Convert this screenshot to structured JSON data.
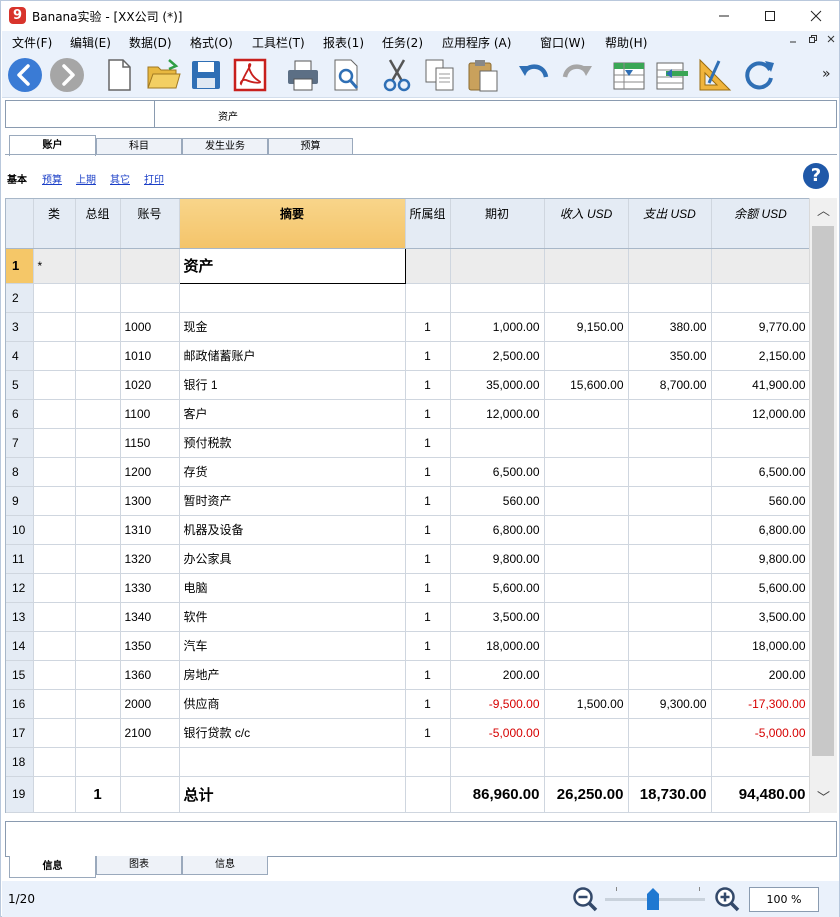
{
  "window": {
    "app_logo": "9",
    "title": "Banana实验 - [XX公司 (*)]",
    "minimize_icon": "minimize-icon",
    "maximize_icon": "maximize-icon",
    "close_icon": "close-icon"
  },
  "menu": {
    "items": [
      "文件(F)",
      "编辑(E)",
      "数据(D)",
      "格式(O)",
      "工具栏(T)",
      "报表(1)",
      "任务(2)",
      "应用程序  (A)",
      "窗口(W)",
      "帮助(H)"
    ]
  },
  "toolbar": {
    "buttons": [
      "back",
      "forward",
      "new-file",
      "open-file",
      "save",
      "pdf",
      "print",
      "print-preview",
      "cut",
      "copy",
      "paste",
      "undo",
      "redo",
      "insert-rows",
      "delete-rows",
      "ruler",
      "recheck"
    ],
    "more": "»"
  },
  "cellbar": {
    "address": "",
    "content": "资产"
  },
  "tables": {
    "tabs": [
      "账户",
      "科目",
      "发生业务",
      "预算"
    ],
    "active": "账户"
  },
  "views": {
    "items": [
      "基本",
      "预算",
      "上期",
      "其它",
      "打印"
    ],
    "current": "基本"
  },
  "help": {
    "label": "?"
  },
  "grid": {
    "columns": [
      "类",
      "总组",
      "账号",
      "摘要",
      "所属组",
      "期初",
      "收入 USD",
      "支出 USD",
      "余额 USD"
    ],
    "rows": [
      {
        "n": "1",
        "cls": "*",
        "grp": "",
        "acc": "",
        "desc": "资产",
        "gr": "",
        "open": "",
        "inc": "",
        "exp": "",
        "bal": ""
      },
      {
        "n": "2",
        "cls": "",
        "grp": "",
        "acc": "",
        "desc": "",
        "gr": "",
        "open": "",
        "inc": "",
        "exp": "",
        "bal": ""
      },
      {
        "n": "3",
        "cls": "",
        "grp": "",
        "acc": "1000",
        "desc": "现金",
        "gr": "1",
        "open": "1,000.00",
        "inc": "9,150.00",
        "exp": "380.00",
        "bal": "9,770.00"
      },
      {
        "n": "4",
        "cls": "",
        "grp": "",
        "acc": "1010",
        "desc": "邮政储蓄账户",
        "gr": "1",
        "open": "2,500.00",
        "inc": "",
        "exp": "350.00",
        "bal": "2,150.00"
      },
      {
        "n": "5",
        "cls": "",
        "grp": "",
        "acc": "1020",
        "desc": "银行 1",
        "gr": "1",
        "open": "35,000.00",
        "inc": "15,600.00",
        "exp": "8,700.00",
        "bal": "41,900.00"
      },
      {
        "n": "6",
        "cls": "",
        "grp": "",
        "acc": "1100",
        "desc": "客户",
        "gr": "1",
        "open": "12,000.00",
        "inc": "",
        "exp": "",
        "bal": "12,000.00"
      },
      {
        "n": "7",
        "cls": "",
        "grp": "",
        "acc": "1150",
        "desc": "预付税款",
        "gr": "1",
        "open": "",
        "inc": "",
        "exp": "",
        "bal": ""
      },
      {
        "n": "8",
        "cls": "",
        "grp": "",
        "acc": "1200",
        "desc": "存货",
        "gr": "1",
        "open": "6,500.00",
        "inc": "",
        "exp": "",
        "bal": "6,500.00"
      },
      {
        "n": "9",
        "cls": "",
        "grp": "",
        "acc": "1300",
        "desc": "暂时资产",
        "gr": "1",
        "open": "560.00",
        "inc": "",
        "exp": "",
        "bal": "560.00"
      },
      {
        "n": "10",
        "cls": "",
        "grp": "",
        "acc": "1310",
        "desc": "机器及设备",
        "gr": "1",
        "open": "6,800.00",
        "inc": "",
        "exp": "",
        "bal": "6,800.00"
      },
      {
        "n": "11",
        "cls": "",
        "grp": "",
        "acc": "1320",
        "desc": "办公家具",
        "gr": "1",
        "open": "9,800.00",
        "inc": "",
        "exp": "",
        "bal": "9,800.00"
      },
      {
        "n": "12",
        "cls": "",
        "grp": "",
        "acc": "1330",
        "desc": "电脑",
        "gr": "1",
        "open": "5,600.00",
        "inc": "",
        "exp": "",
        "bal": "5,600.00"
      },
      {
        "n": "13",
        "cls": "",
        "grp": "",
        "acc": "1340",
        "desc": "软件",
        "gr": "1",
        "open": "3,500.00",
        "inc": "",
        "exp": "",
        "bal": "3,500.00"
      },
      {
        "n": "14",
        "cls": "",
        "grp": "",
        "acc": "1350",
        "desc": "汽车",
        "gr": "1",
        "open": "18,000.00",
        "inc": "",
        "exp": "",
        "bal": "18,000.00"
      },
      {
        "n": "15",
        "cls": "",
        "grp": "",
        "acc": "1360",
        "desc": "房地产",
        "gr": "1",
        "open": "200.00",
        "inc": "",
        "exp": "",
        "bal": "200.00"
      },
      {
        "n": "16",
        "cls": "",
        "grp": "",
        "acc": "2000",
        "desc": "供应商",
        "gr": "1",
        "open": "-9,500.00",
        "inc": "1,500.00",
        "exp": "9,300.00",
        "bal": "-17,300.00"
      },
      {
        "n": "17",
        "cls": "",
        "grp": "",
        "acc": "2100",
        "desc": "银行贷款 c/c",
        "gr": "1",
        "open": "-5,000.00",
        "inc": "",
        "exp": "",
        "bal": "-5,000.00"
      },
      {
        "n": "18",
        "cls": "",
        "grp": "",
        "acc": "",
        "desc": "",
        "gr": "",
        "open": "",
        "inc": "",
        "exp": "",
        "bal": ""
      },
      {
        "n": "19",
        "cls": "",
        "grp": "1",
        "acc": "",
        "desc": "总计",
        "gr": "",
        "open": "86,960.00",
        "inc": "26,250.00",
        "exp": "18,730.00",
        "bal": "94,480.00"
      }
    ],
    "negative_color": "#d60000"
  },
  "scrollbar": {
    "up": "︿",
    "down": "﹀"
  },
  "info_tabs": {
    "tabs": [
      "信息",
      "图表",
      "信息"
    ],
    "active_index": 0
  },
  "status": {
    "position": "1/20",
    "zoom": "100 %",
    "zoom_level_percent": 100
  },
  "colors": {
    "accent": "#f5c768",
    "toolbar_bg": "#eaf1fb",
    "link": "#1b3fc7"
  }
}
